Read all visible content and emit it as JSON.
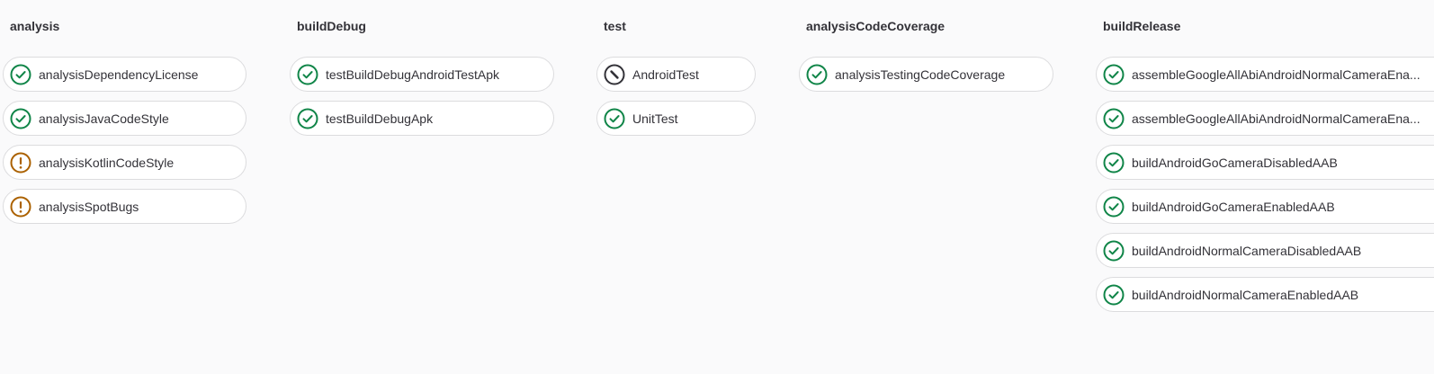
{
  "stages": [
    {
      "name": "analysis",
      "jobs": [
        {
          "name": "analysisDependencyLicense",
          "status": "success-icon"
        },
        {
          "name": "analysisJavaCodeStyle",
          "status": "success-icon"
        },
        {
          "name": "analysisKotlinCodeStyle",
          "status": "warning-icon"
        },
        {
          "name": "analysisSpotBugs",
          "status": "warning-icon"
        }
      ]
    },
    {
      "name": "buildDebug",
      "jobs": [
        {
          "name": "testBuildDebugAndroidTestApk",
          "status": "success-icon"
        },
        {
          "name": "testBuildDebugApk",
          "status": "success-icon"
        }
      ]
    },
    {
      "name": "test",
      "jobs": [
        {
          "name": "AndroidTest",
          "status": "skipped-icon"
        },
        {
          "name": "UnitTest",
          "status": "success-icon"
        }
      ]
    },
    {
      "name": "analysisCodeCoverage",
      "jobs": [
        {
          "name": "analysisTestingCodeCoverage",
          "status": "success-icon"
        }
      ]
    },
    {
      "name": "buildRelease",
      "jobs": [
        {
          "name": "assembleGoogleAllAbiAndroidNormalCameraEna...",
          "status": "success-icon"
        },
        {
          "name": "assembleGoogleAllAbiAndroidNormalCameraEna...",
          "status": "success-icon"
        },
        {
          "name": "buildAndroidGoCameraDisabledAAB",
          "status": "success-icon"
        },
        {
          "name": "buildAndroidGoCameraEnabledAAB",
          "status": "success-icon"
        },
        {
          "name": "buildAndroidNormalCameraDisabledAAB",
          "status": "success-icon"
        },
        {
          "name": "buildAndroidNormalCameraEnabledAAB",
          "status": "success-icon"
        }
      ]
    }
  ],
  "colors": {
    "success": "#108548",
    "warning": "#ab6100",
    "skipped": "#333238",
    "border": "#dcdcde",
    "background": "#fafafb"
  }
}
